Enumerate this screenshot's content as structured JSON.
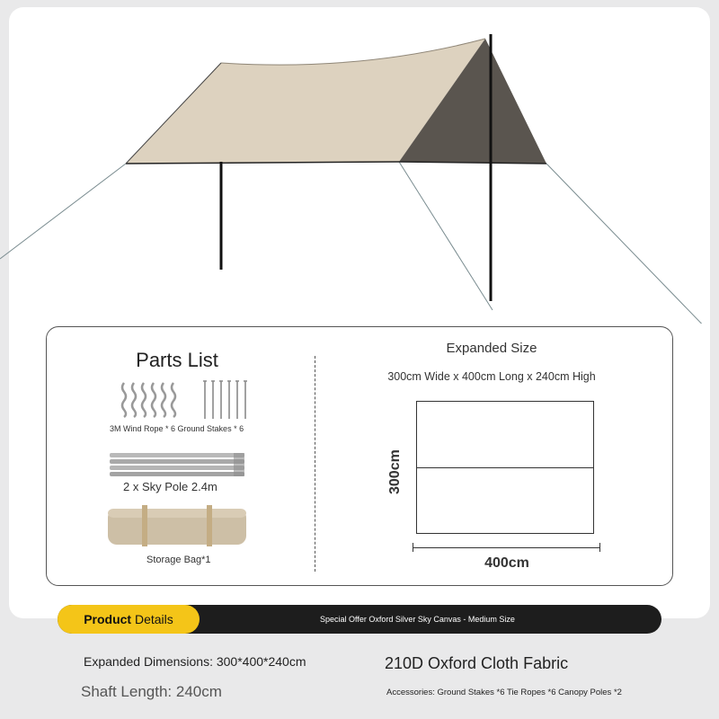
{
  "parts_list": {
    "title": "Parts List",
    "rope_stakes_label": "3M Wind Rope * 6 Ground Stakes * 6",
    "sky_pole_label": "2 x Sky Pole 2.4m",
    "storage_bag_label": "Storage Bag*1"
  },
  "expanded_size": {
    "title": "Expanded Size",
    "dimensions": "300cm Wide x 400cm Long x 240cm High",
    "width_label": "300cm",
    "length_label": "400cm"
  },
  "product_details": {
    "label_strong": "Product",
    "label_rest": " Details",
    "product_name": "Special Offer Oxford Silver Sky Canvas - Medium Size"
  },
  "specs": {
    "expanded_dimensions": "Expanded Dimensions: 300*400*240cm",
    "fabric": "210D Oxford Cloth Fabric",
    "shaft_length": "Shaft Length: 240cm",
    "accessories": "Accessories: Ground Stakes *6 Tie Ropes *6 Canopy Poles *2"
  },
  "colors": {
    "tarp_top": "#ddd2bf",
    "tarp_side": "#5a554f",
    "accent": "#f4c518",
    "bar": "#1d1d1d"
  }
}
